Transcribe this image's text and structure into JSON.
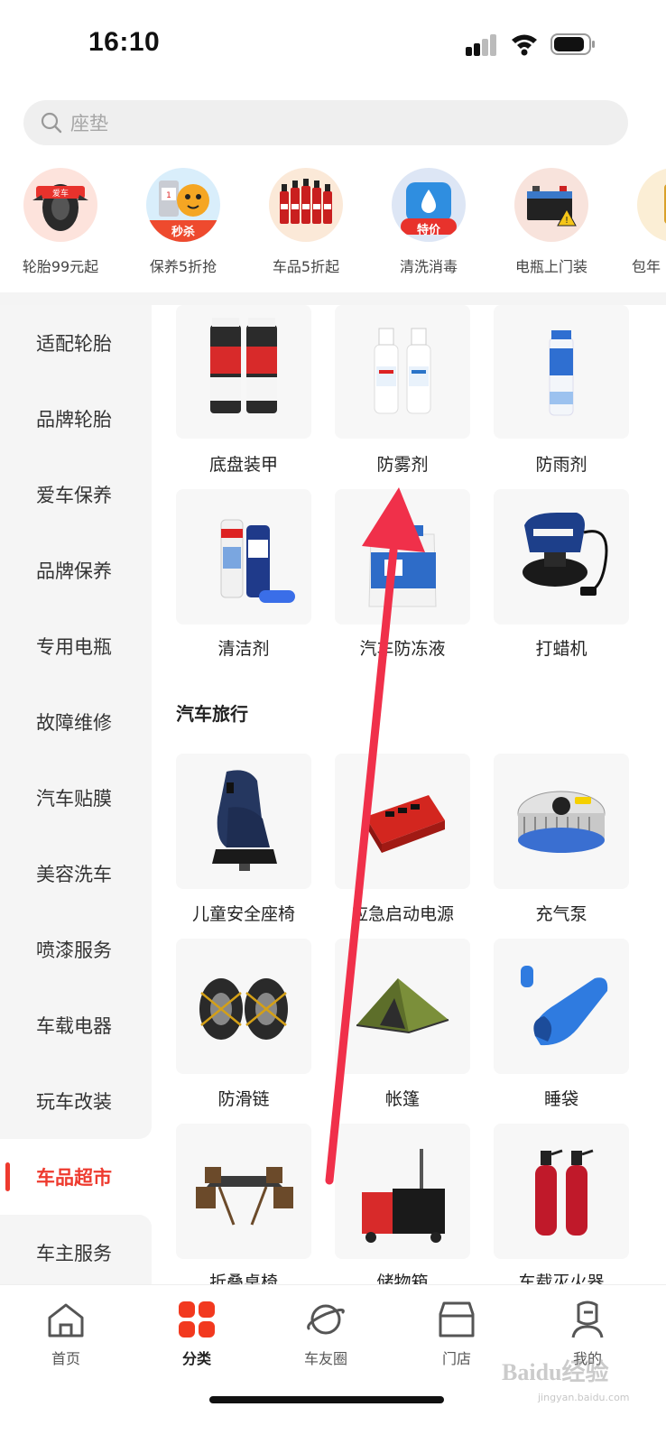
{
  "status_bar": {
    "time": "16:10"
  },
  "search": {
    "placeholder": "座垫"
  },
  "quick_categories": [
    {
      "label": "轮胎99元起",
      "badge": ""
    },
    {
      "label": "保养5折抢",
      "badge": "秒杀"
    },
    {
      "label": "车品5折起",
      "badge": ""
    },
    {
      "label": "清洗消毒",
      "badge": "特价"
    },
    {
      "label": "电瓶上门装",
      "badge": ""
    },
    {
      "label": "包年",
      "badge": ""
    }
  ],
  "sidebar": {
    "items": [
      {
        "label": "适配轮胎"
      },
      {
        "label": "品牌轮胎"
      },
      {
        "label": "爱车保养"
      },
      {
        "label": "品牌保养"
      },
      {
        "label": "专用电瓶"
      },
      {
        "label": "故障维修"
      },
      {
        "label": "汽车贴膜"
      },
      {
        "label": "美容洗车"
      },
      {
        "label": "喷漆服务"
      },
      {
        "label": "车载电器"
      },
      {
        "label": "玩车改装"
      },
      {
        "label": "车品超市"
      },
      {
        "label": "车主服务"
      }
    ],
    "active_index": 11
  },
  "products_top": [
    {
      "name": "底盘装甲",
      "icon": "underbody-coating-cans"
    },
    {
      "name": "防雾剂",
      "icon": "anti-fog-spray-bottles"
    },
    {
      "name": "防雨剂",
      "icon": "rain-repellent-can"
    },
    {
      "name": "清洁剂",
      "icon": "cleaner-cans"
    },
    {
      "name": "汽车防冻液",
      "icon": "antifreeze-jug"
    },
    {
      "name": "打蜡机",
      "icon": "car-polisher"
    }
  ],
  "section_travel": {
    "title": "汽车旅行",
    "products": [
      {
        "name": "儿童安全座椅",
        "icon": "child-car-seat"
      },
      {
        "name": "应急启动电源",
        "icon": "jump-starter"
      },
      {
        "name": "充气泵",
        "icon": "air-pump"
      },
      {
        "name": "防滑链",
        "icon": "snow-chains"
      },
      {
        "name": "帐篷",
        "icon": "tent"
      },
      {
        "name": "睡袋",
        "icon": "sleeping-bag"
      },
      {
        "name": "折叠桌椅",
        "icon": "folding-table-chairs"
      },
      {
        "name": "储物箱",
        "icon": "storage-cart"
      },
      {
        "name": "车载灭火器",
        "icon": "fire-extinguisher"
      }
    ]
  },
  "bottom_nav": [
    {
      "label": "首页",
      "icon": "home-icon"
    },
    {
      "label": "分类",
      "icon": "category-grid-icon"
    },
    {
      "label": "车友圈",
      "icon": "planet-icon"
    },
    {
      "label": "门店",
      "icon": "store-icon"
    },
    {
      "label": "我的",
      "icon": "profile-icon"
    }
  ],
  "watermark": {
    "text": "Baidu经验",
    "url": "jingyan.baidu.com"
  },
  "colors": {
    "accent": "#ee3a2e",
    "annotation_arrow": "#f0304a"
  }
}
